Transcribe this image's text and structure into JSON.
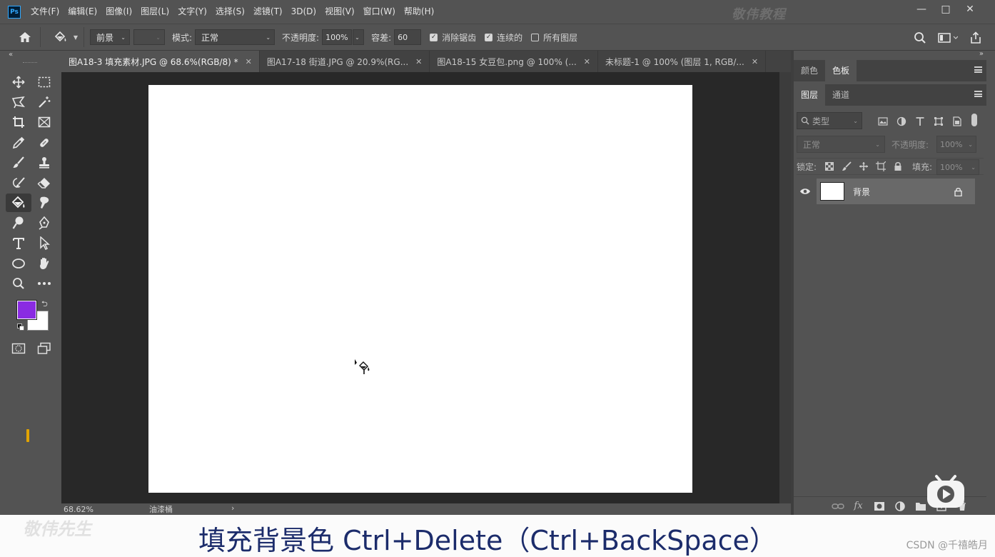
{
  "app": {
    "logo": "Ps",
    "watermark": "敬伟教程"
  },
  "menu": [
    "文件(F)",
    "编辑(E)",
    "图像(I)",
    "图层(L)",
    "文字(Y)",
    "选择(S)",
    "滤镜(T)",
    "3D(D)",
    "视图(V)",
    "窗口(W)",
    "帮助(H)"
  ],
  "window_controls": {
    "minimize": "—",
    "maximize": "□",
    "close": "✕"
  },
  "options": {
    "fill_source": "前景",
    "mode_label": "模式:",
    "mode_value": "正常",
    "opacity_label": "不透明度:",
    "opacity_value": "100%",
    "tolerance_label": "容差:",
    "tolerance_value": "60",
    "antialias_label": "消除锯齿",
    "antialias_checked": true,
    "contiguous_label": "连续的",
    "contiguous_checked": true,
    "all_layers_label": "所有图层",
    "all_layers_checked": false
  },
  "tabs": [
    {
      "label": "图A18-3 填充素材.JPG @ 68.6%(RGB/8) *",
      "active": true
    },
    {
      "label": "图A17-18 街道.JPG @ 20.9%(RG...",
      "active": false
    },
    {
      "label": "图A18-15 女豆包.png @ 100% (...",
      "active": false
    },
    {
      "label": "未标题-1 @ 100% (图层 1, RGB/...",
      "active": false
    }
  ],
  "tools": {
    "active": "paint-bucket-tool",
    "foreground_color": "#8a2be2",
    "background_color": "#ffffff"
  },
  "status": {
    "zoom": "68.62%",
    "info": "油漆桶"
  },
  "panels": {
    "top_tabs": [
      "颜色",
      "色板"
    ],
    "top_active": "色板",
    "layer_tabs": [
      "图层",
      "通道"
    ],
    "layer_active": "图层",
    "filter_placeholder": "类型",
    "blend_mode": "正常",
    "opacity_label": "不透明度:",
    "opacity_value": "100%",
    "lock_label": "锁定:",
    "fill_label": "填充:",
    "fill_value": "100%",
    "layers": [
      {
        "name": "背景",
        "locked": true,
        "visible": true
      }
    ]
  },
  "subtitle": {
    "watermark": "敬伟先生 ",
    "text": "填充背景色 Ctrl+Delete（Ctrl+BackSpace）",
    "credit": "CSDN @千禧皓月"
  }
}
